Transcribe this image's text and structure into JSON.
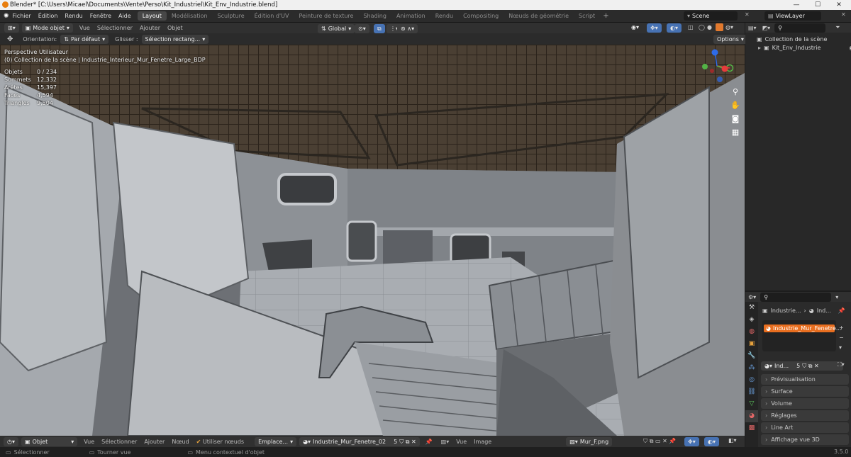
{
  "window": {
    "title": "Blender* [C:\\Users\\Micael\\Documents\\Vente\\Perso\\Kit_Industriel\\Kit_Env_Industrie.blend]",
    "minimize": "—",
    "maximize": "☐",
    "close": "✕"
  },
  "menu": [
    "Fichier",
    "Édition",
    "Rendu",
    "Fenêtre",
    "Aide"
  ],
  "workspaces": [
    "Layout",
    "Modélisation",
    "Sculpture",
    "Édition d'UV",
    "Peinture de texture",
    "Shading",
    "Animation",
    "Rendu",
    "Compositing",
    "Nœuds de géométrie",
    "Script"
  ],
  "active_workspace": "Layout",
  "scene": "Scene",
  "viewlayer": "ViewLayer",
  "header": {
    "mode": "Mode objet",
    "vue": "Vue",
    "select": "Sélectionner",
    "add": "Ajouter",
    "object": "Objet",
    "transform": "Global"
  },
  "header2": {
    "orientation_label": "Orientation:",
    "orientation": "Par défaut",
    "drag_label": "Glisser :",
    "drag": "Sélection rectang...",
    "options": "Options"
  },
  "viewport": {
    "view_name": "Perspective Utilisateur",
    "collection": "(0) Collection de la scène | Industrie_Interieur_Mur_Fenetre_Large_BDP",
    "stats": [
      {
        "k": "Objets",
        "v": "0 / 234"
      },
      {
        "k": "Sommets",
        "v": "12,332"
      },
      {
        "k": "Arêtes",
        "v": "15,397"
      },
      {
        "k": "Faces",
        "v": "4,594"
      },
      {
        "k": "Triangles",
        "v": "9,504"
      }
    ]
  },
  "gizmo": {
    "x": "X",
    "y": "Y",
    "z": "Z"
  },
  "outliner": {
    "root": "Collection de la scène",
    "item": "Kit_Env_Industrie"
  },
  "properties": {
    "breadcrumb1": "Industrie...",
    "breadcrumb2": "Ind...",
    "material_slot": "Industrie_Mur_Fenetre...",
    "mat_name": "Ind...",
    "users": "5",
    "panels": [
      "Prévisualisation",
      "Surface",
      "Volume",
      "Réglages",
      "Line Art",
      "Affichage vue 3D"
    ]
  },
  "bottom": {
    "editor": "Objet",
    "vue": "Vue",
    "select": "Sélectionner",
    "add": "Ajouter",
    "node": "Nœud",
    "use_nodes": "Utiliser nœuds",
    "slot": "Emplace...",
    "material": "Industrie_Mur_Fenetre_02",
    "users": "5",
    "vue2": "Vue",
    "image": "Image",
    "image_name": "Mur_F.png"
  },
  "status": {
    "select": "Sélectionner",
    "rotate": "Tourner vue",
    "context": "Menu contextuel d'objet",
    "version": "3.5.0"
  }
}
